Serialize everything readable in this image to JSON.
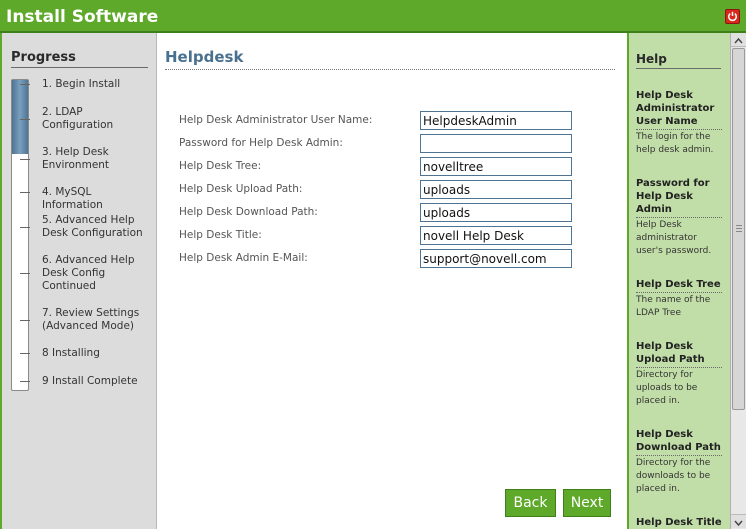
{
  "window": {
    "title": "Install Software"
  },
  "progress": {
    "title": "Progress",
    "completion": 0.24,
    "steps": [
      "1. Begin Install",
      "2. LDAP Configuration",
      "3. Help Desk Environment",
      "4. MySQL Information",
      "5. Advanced Help Desk Configuration",
      "6. Advanced Help Desk Config Continued",
      "7. Review Settings (Advanced Mode)",
      "8 Installing",
      "9 Install Complete"
    ]
  },
  "main": {
    "title": "Helpdesk",
    "fields": [
      {
        "label": "Help Desk Administrator User Name:",
        "value": "HelpdeskAdmin"
      },
      {
        "label": "Password for Help Desk Admin:",
        "value": ""
      },
      {
        "label": "Help Desk Tree:",
        "value": "novelltree"
      },
      {
        "label": "Help Desk Upload Path:",
        "value": "uploads"
      },
      {
        "label": "Help Desk Download Path:",
        "value": "uploads"
      },
      {
        "label": "Help Desk Title:",
        "value": "novell Help Desk"
      },
      {
        "label": "Help Desk Admin E-Mail:",
        "value": "support@novell.com"
      }
    ],
    "back_label": "Back",
    "next_label": "Next"
  },
  "help": {
    "title": "Help",
    "entries": [
      {
        "head": "Help Desk Administrator User Name",
        "text": "The login for the help desk admin."
      },
      {
        "head": "Password for Help Desk Admin",
        "text": "Help Desk administrator user's password."
      },
      {
        "head": "Help Desk Tree",
        "text": "The name of the LDAP Tree"
      },
      {
        "head": "Help Desk Upload Path",
        "text": "Directory for uploads to be placed in."
      },
      {
        "head": "Help Desk Download Path",
        "text": "Directory for the downloads to be placed in."
      },
      {
        "head": "Help Desk Title",
        "text": ""
      }
    ]
  },
  "colors": {
    "accent": "#5ea82a",
    "progress_fill": "#4e7393",
    "help_bg": "#c2dea8",
    "close": "#d8281c"
  }
}
